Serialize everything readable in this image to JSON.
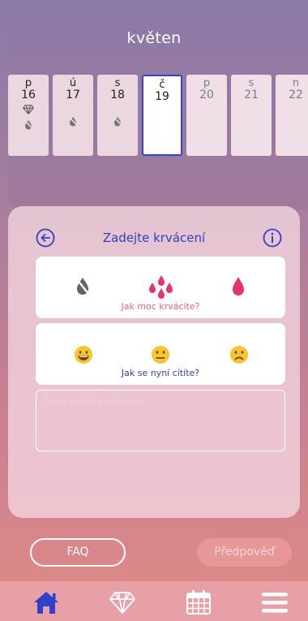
{
  "header": {
    "month": "květen"
  },
  "days": [
    {
      "weekday": "p",
      "date": "16",
      "state": "past",
      "icons": [
        "diamond-icon",
        "flow-none-icon"
      ]
    },
    {
      "weekday": "ú",
      "date": "17",
      "state": "past",
      "icons": [
        "flow-none-icon"
      ]
    },
    {
      "weekday": "s",
      "date": "18",
      "state": "past",
      "icons": [
        "flow-none-icon"
      ]
    },
    {
      "weekday": "č",
      "date": "19",
      "state": "selected",
      "icons": []
    },
    {
      "weekday": "p",
      "date": "20",
      "state": "future",
      "icons": []
    },
    {
      "weekday": "s",
      "date": "21",
      "state": "future",
      "icons": []
    },
    {
      "weekday": "n",
      "date": "22",
      "state": "future",
      "icons": []
    }
  ],
  "panel": {
    "title": "Zadejte krvácení",
    "bleeding_label": "Jak moc krvácíte?",
    "feeling_label": "Jak se nyní cítíte?",
    "notes_placeholder": "Zde zadejte poznámky"
  },
  "buttons": {
    "faq": "FAQ",
    "prediction": "Předpověď"
  },
  "colors": {
    "accent": "#2f41c8",
    "blood": "#e8336e",
    "card_label_pink": "#e8628e",
    "nav_bar": "#e7a0a6"
  },
  "nav": [
    "home-icon",
    "diamond-icon",
    "calendar-icon",
    "menu-icon"
  ]
}
